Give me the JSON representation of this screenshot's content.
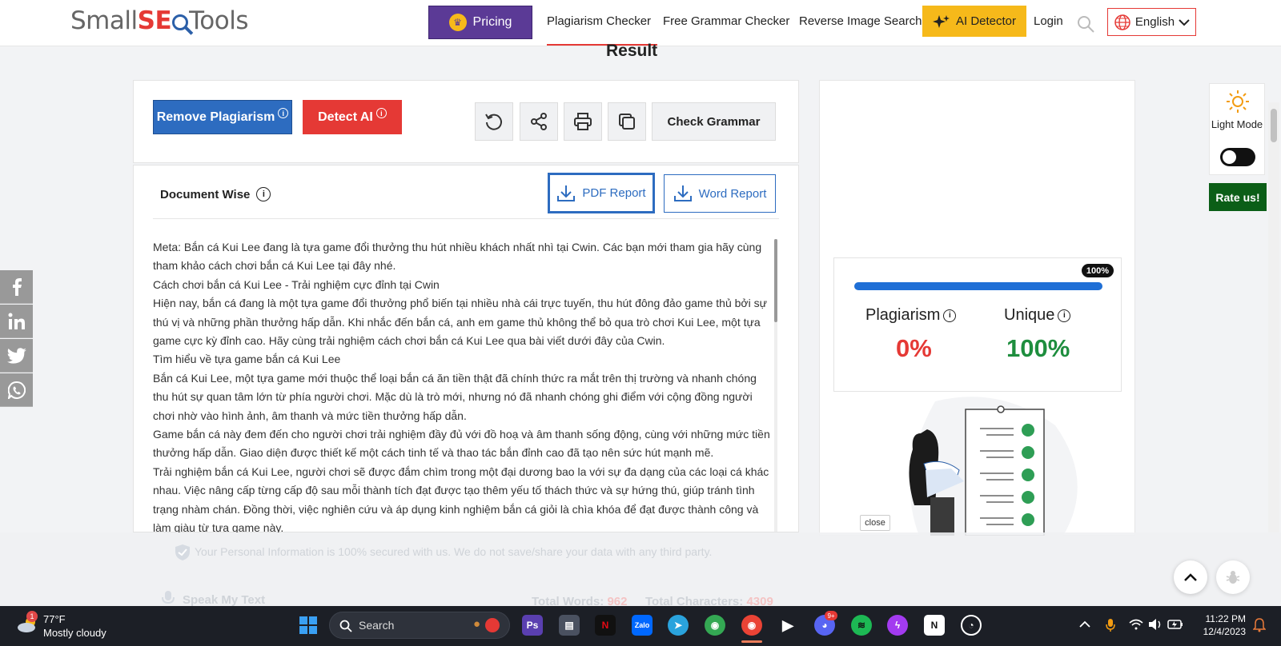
{
  "header": {
    "logo_small": "Small",
    "logo_seo_s": "S",
    "logo_seo_e": "E",
    "logo_tools": "Tools",
    "pricing_label": "Pricing",
    "nav": [
      "Plagiarism Checker",
      "Free Grammar Checker",
      "Reverse Image Search"
    ],
    "ai_detector_label": "AI Detector",
    "login_label": "Login",
    "language": "English"
  },
  "result_heading": "Result",
  "toolbar": {
    "remove_plagiarism": "Remove Plagiarism",
    "detect_ai": "Detect AI",
    "check_grammar": "Check Grammar"
  },
  "report": {
    "document_wise": "Document Wise",
    "pdf_report": "PDF Report",
    "word_report": "Word Report"
  },
  "document": {
    "paragraphs": [
      "Meta: Bắn cá Kui Lee đang là tựa game đổi thưởng thu hút nhiều khách nhất nhì tại Cwin. Các bạn mới tham gia hãy cùng tham khảo cách chơi bắn cá Kui Lee tại đây nhé.",
      "Cách chơi bắn cá Kui Lee - Trải nghiệm cực đỉnh tại Cwin",
      "Hiện nay, bắn cá đang là một tựa game đổi thưởng phổ biến tại nhiều nhà cái trực tuyến, thu hút đông đảo game thủ bởi sự thú vị và những phần thưởng hấp dẫn. Khi nhắc đến bắn cá, anh em game thủ không thể bỏ qua trò chơi Kui Lee, một tựa game cực kỳ đỉnh cao. Hãy cùng trải nghiệm cách chơi bắn cá Kui Lee qua bài viết dưới đây của Cwin.",
      "Tìm hiểu về tựa game bắn cá Kui Lee",
      "Bắn cá Kui Lee, một tựa game mới thuộc thể loại bắn cá ăn tiền thật đã chính thức ra mắt trên thị trường và nhanh chóng thu hút sự quan tâm lớn từ phía người chơi. Mặc dù là trò mới, nhưng nó đã nhanh chóng ghi điểm với cộng đồng người chơi nhờ vào hình ảnh, âm thanh và mức tiền thưởng hấp dẫn.",
      "Game bắn cá này đem đến cho người chơi trải nghiệm đầy đủ với đồ hoạ và âm thanh sống động, cùng với những mức tiền thưởng hấp dẫn. Giao diện được thiết kế một cách tinh tế và thao tác bắn đỉnh cao đã tạo nên sức hút mạnh mẽ.",
      "Trải nghiệm bắn cá Kui Lee, người chơi sẽ được đắm chìm trong một đại dương bao la với sự đa dạng của các loại cá khác nhau. Việc nâng cấp từng cấp độ sau mỗi thành tích đạt được tạo thêm yếu tố thách thức và sự hứng thú, giúp tránh tình trạng nhàm chán. Đồng thời, việc nghiên cứu và áp dụng kinh nghiệm bắn cá giỏi là chìa khóa để đạt được thành công và làm giàu từ tựa game này."
    ]
  },
  "scores": {
    "progress_percent": 100,
    "progress_badge": "100%",
    "plagiarism_label": "Plagiarism",
    "plagiarism_value": "0%",
    "unique_label": "Unique",
    "unique_value": "100%",
    "colors": {
      "plagiarism": "#e53935",
      "unique": "#1e8e3e",
      "progress": "#1f6fd6"
    }
  },
  "close_label": "close",
  "mode": {
    "label": "Light Mode"
  },
  "rate_us": "Rate us!",
  "social": [
    "f",
    "in",
    "tw",
    "wa"
  ],
  "footer": {
    "secure_text": "Your Personal Information is 100% secured with us. We do not save/share your data with any third party.",
    "speak_text": "Speak My Text",
    "total_words_label": "Total Words:",
    "total_words_value": "962",
    "total_chars_label": "Total Characters:",
    "total_chars_value": "4309"
  },
  "taskbar": {
    "weather_badge": "1",
    "temperature": "77°F",
    "condition": "Mostly cloudy",
    "search_label": "Search",
    "discord_badge": "9+",
    "time": "11:22 PM",
    "date": "12/4/2023"
  }
}
